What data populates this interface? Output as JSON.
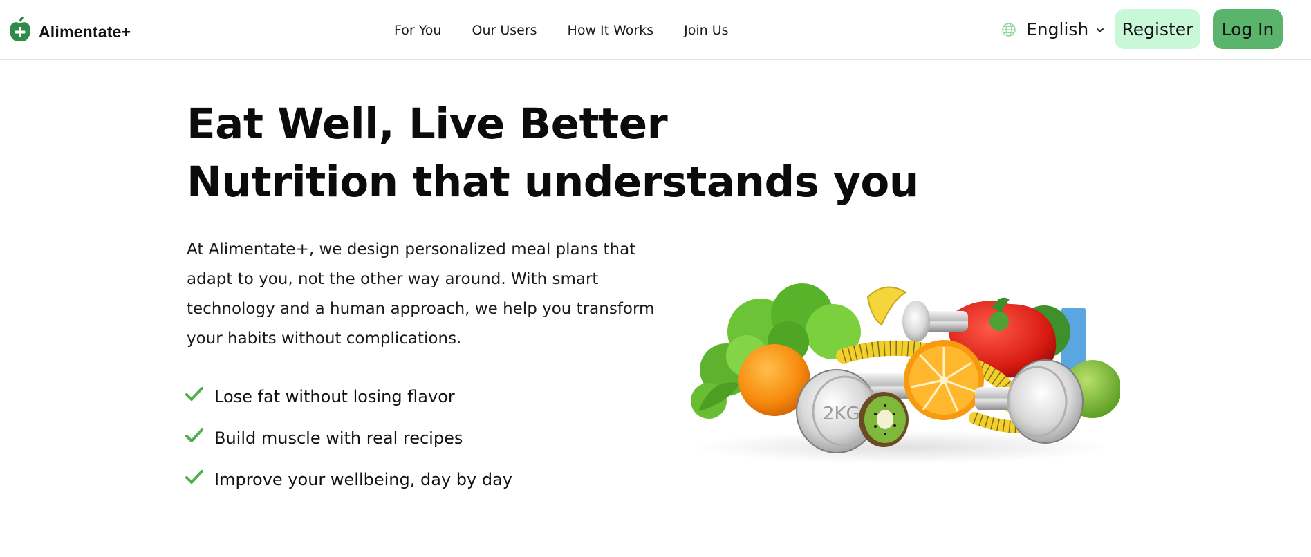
{
  "brand": {
    "name": "Alimentate+",
    "icon": "apple-plus-icon",
    "color": "#2e7d46"
  },
  "nav": {
    "items": [
      {
        "label": "For You"
      },
      {
        "label": "Our Users"
      },
      {
        "label": "How It Works"
      },
      {
        "label": "Join Us"
      }
    ]
  },
  "language": {
    "icon": "globe-icon",
    "selected": "English"
  },
  "buttons": {
    "register": "Register",
    "login": "Log In",
    "register_color": "#c9f8d9",
    "login_color": "#5ab46c"
  },
  "hero": {
    "title_line1": "Eat Well, Live Better",
    "title_line2": "Nutrition that understands you",
    "description": "At Alimentate+, we design personalized meal plans that adapt to you, not the other way around. With smart technology and a human approach, we help you transform your habits without complications.",
    "features": [
      {
        "icon": "check-icon",
        "text": "Lose fat without losing flavor"
      },
      {
        "icon": "check-icon",
        "text": "Build muscle with real recipes"
      },
      {
        "icon": "check-icon",
        "text": "Improve your wellbeing, day by day"
      }
    ],
    "accent_color": "#4caf50"
  },
  "illustration": {
    "dumbbell_label": "2KG"
  }
}
